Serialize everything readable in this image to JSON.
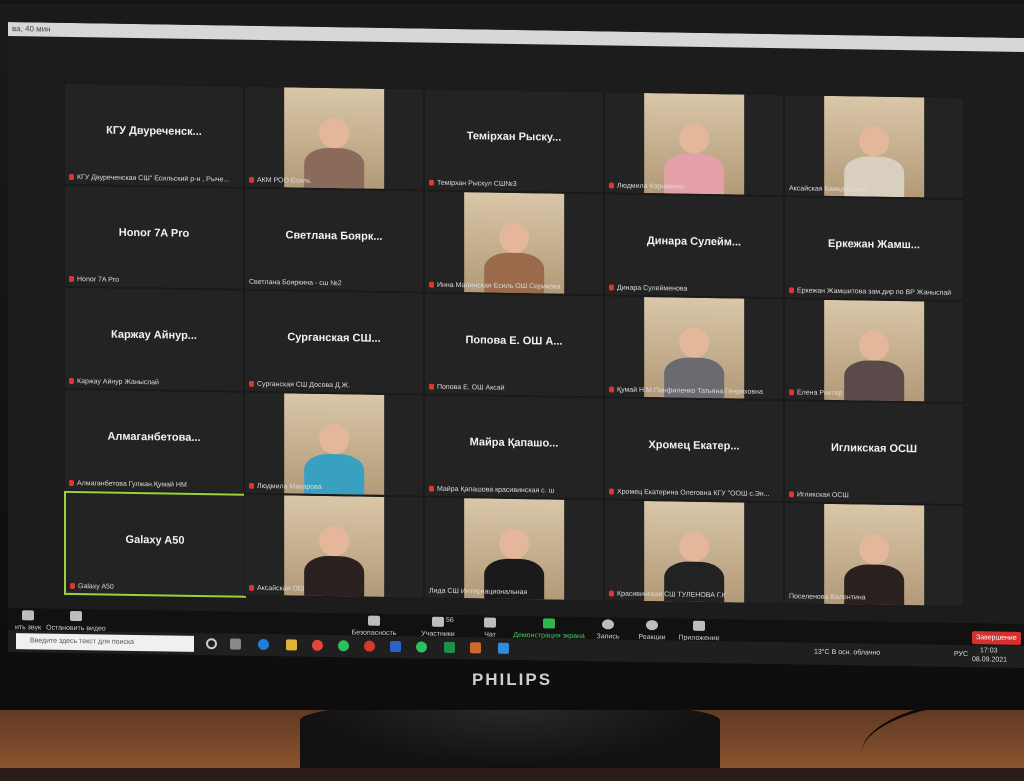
{
  "window_title_fragment": "ва, 40 мин",
  "brand": "PHILIPS",
  "tiles": [
    {
      "name": "КГУ Двуреченск...",
      "label": "КГУ Двуреченская СШ\" Есильский р-н , Рыче...",
      "video": false,
      "muted": true
    },
    {
      "name": "",
      "label": "АКМ РОО Есиль",
      "video": true,
      "muted": true,
      "tone": "#8a6a5a"
    },
    {
      "name": "Темірхан Рыску...",
      "label": "Темірхан Рыскул СШ№3",
      "video": false,
      "muted": true
    },
    {
      "name": "",
      "label": "Людмила Корниенко",
      "video": true,
      "muted": true,
      "tone": "#e3a0a8"
    },
    {
      "name": "",
      "label": "Аксайская Баяндинская",
      "video": true,
      "muted": false,
      "tone": "#d9cfc0"
    },
    {
      "name": "Honor 7A Pro",
      "label": "Honor 7A Pro",
      "video": false,
      "muted": true
    },
    {
      "name": "Светлана Боярк...",
      "label": "Светлана Бояркина - сш №2",
      "video": false,
      "muted": false
    },
    {
      "name": "",
      "label": "Инна Малинская Есиль ОШ Серикова",
      "video": true,
      "muted": true,
      "tone": "#9a6a4a"
    },
    {
      "name": "Динара Сулейм...",
      "label": "Динара Сулейменова",
      "video": false,
      "muted": true
    },
    {
      "name": "Еркежан Жамш...",
      "label": "Еркежан Жамшитова зам.дир по ВР Жаныспай",
      "video": false,
      "muted": true
    },
    {
      "name": "Каржау Айнур...",
      "label": "Каржау Айнур Жаныспай",
      "video": false,
      "muted": true
    },
    {
      "name": "Сурганская СШ...",
      "label": "Сурганская СШ Досова Д.Ж.",
      "video": false,
      "muted": true
    },
    {
      "name": "Попова Е. ОШ А...",
      "label": "Попова Е. ОШ Аксай",
      "video": false,
      "muted": true
    },
    {
      "name": "",
      "label": "Қумай Н.М.Панфиленко Татьяна Генриховна",
      "video": true,
      "muted": true,
      "tone": "#6a6a70"
    },
    {
      "name": "",
      "label": "Елена Рихтер",
      "video": true,
      "muted": true,
      "tone": "#5a4a4a"
    },
    {
      "name": "Алмаганбетова...",
      "label": "Алмаганбетова Гулжан.Қумай НМ",
      "video": false,
      "muted": true
    },
    {
      "name": "",
      "label": "Людмила Макарова",
      "video": true,
      "muted": true,
      "tone": "#3aa0c0"
    },
    {
      "name": "Майра Қапашо...",
      "label": "Майра Қапашова красивинская с. ш",
      "video": false,
      "muted": true
    },
    {
      "name": "Хромец Екатер...",
      "label": "Хромец Екатерина Олеговна КГУ \"ООШ с.Эн...",
      "video": false,
      "muted": true
    },
    {
      "name": "Игликская ОСШ",
      "label": "Игликская ОСШ",
      "video": false,
      "muted": true
    },
    {
      "name": "Galaxy A50",
      "label": "Galaxy A50",
      "video": false,
      "muted": true,
      "active": true
    },
    {
      "name": "",
      "label": "Аксайская ОШ",
      "video": true,
      "muted": true,
      "tone": "#2a2020"
    },
    {
      "name": "",
      "label": "Лида СШ Интернациональная",
      "video": true,
      "muted": false,
      "tone": "#1a1a1a"
    },
    {
      "name": "",
      "label": "Красивинская СШ ТУЛЕНОВА Г.К",
      "video": true,
      "muted": true,
      "tone": "#222"
    },
    {
      "name": "",
      "label": "Поселенова Валентина",
      "video": true,
      "muted": false,
      "tone": "#2a2020"
    }
  ],
  "toolbar": {
    "audio": "ить звук",
    "video": "Остановить видео",
    "security": "Безопасность",
    "participants": "Участники",
    "participants_count": "56",
    "chat": "Чат",
    "share": "Демонстрация экрана",
    "record": "Запись",
    "reactions": "Реакции",
    "apps": "Приложение",
    "end": "Завершение"
  },
  "taskbar": {
    "search_placeholder": "Введите здесь текст для поиска",
    "weather": "13°C В осн. облачно",
    "lang": "РУС",
    "time": "17:03",
    "date": "08.09.2021"
  },
  "colors": {
    "active_border": "#9bd13a",
    "end_button": "#d3302f",
    "muted_mic": "#e03535"
  }
}
